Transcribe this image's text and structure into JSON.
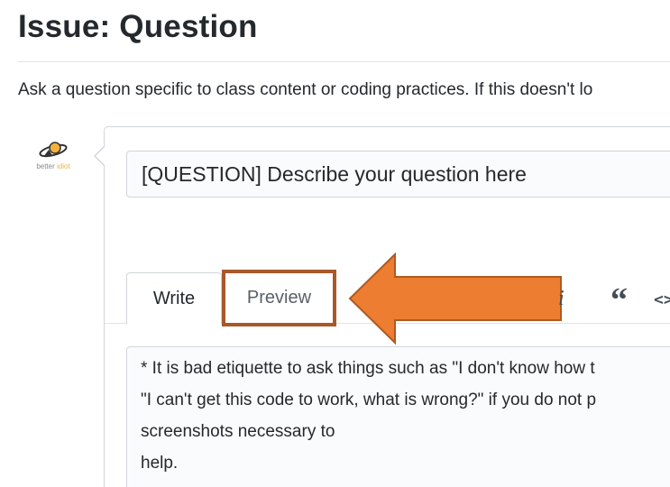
{
  "page": {
    "title": "Issue: Question",
    "description": "Ask a question specific to class content or coding practices. If this doesn't lo"
  },
  "avatar": {
    "icon": "planet-logo-icon",
    "text_part1": "better ",
    "text_part2": "idiot"
  },
  "form": {
    "title_value": "[QUESTION] Describe your question here",
    "tabs": [
      {
        "label": "Write",
        "selected": true
      },
      {
        "label": "Preview",
        "selected": false
      }
    ],
    "toolbar": {
      "italic": "i",
      "quote": "“",
      "code": "<>"
    },
    "body_lines": [
      "* It is bad etiquette to ask things such as \"I don't know how t",
      "\"I can't get this code to work, what is wrong?\" if you do not p",
      "screenshots necessary to",
      "help."
    ]
  },
  "colors": {
    "highlight_border": "#a9582a",
    "arrow_fill": "#ed7d31",
    "arrow_stroke": "#ae5a21"
  }
}
